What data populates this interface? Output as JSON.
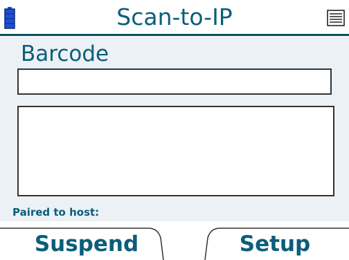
{
  "header": {
    "title": "Scan-to-IP",
    "battery_icon": "battery-icon",
    "menu_icon": "menu-icon"
  },
  "main": {
    "section_label": "Barcode",
    "barcode_value": "",
    "output_value": "",
    "status_text": "Paired to host:"
  },
  "softkeys": {
    "left_label": "Suspend",
    "right_label": "Setup"
  },
  "colors": {
    "accent": "#0b5e7a",
    "battery": "#1f4fd6",
    "panel": "#ecf1f5"
  }
}
